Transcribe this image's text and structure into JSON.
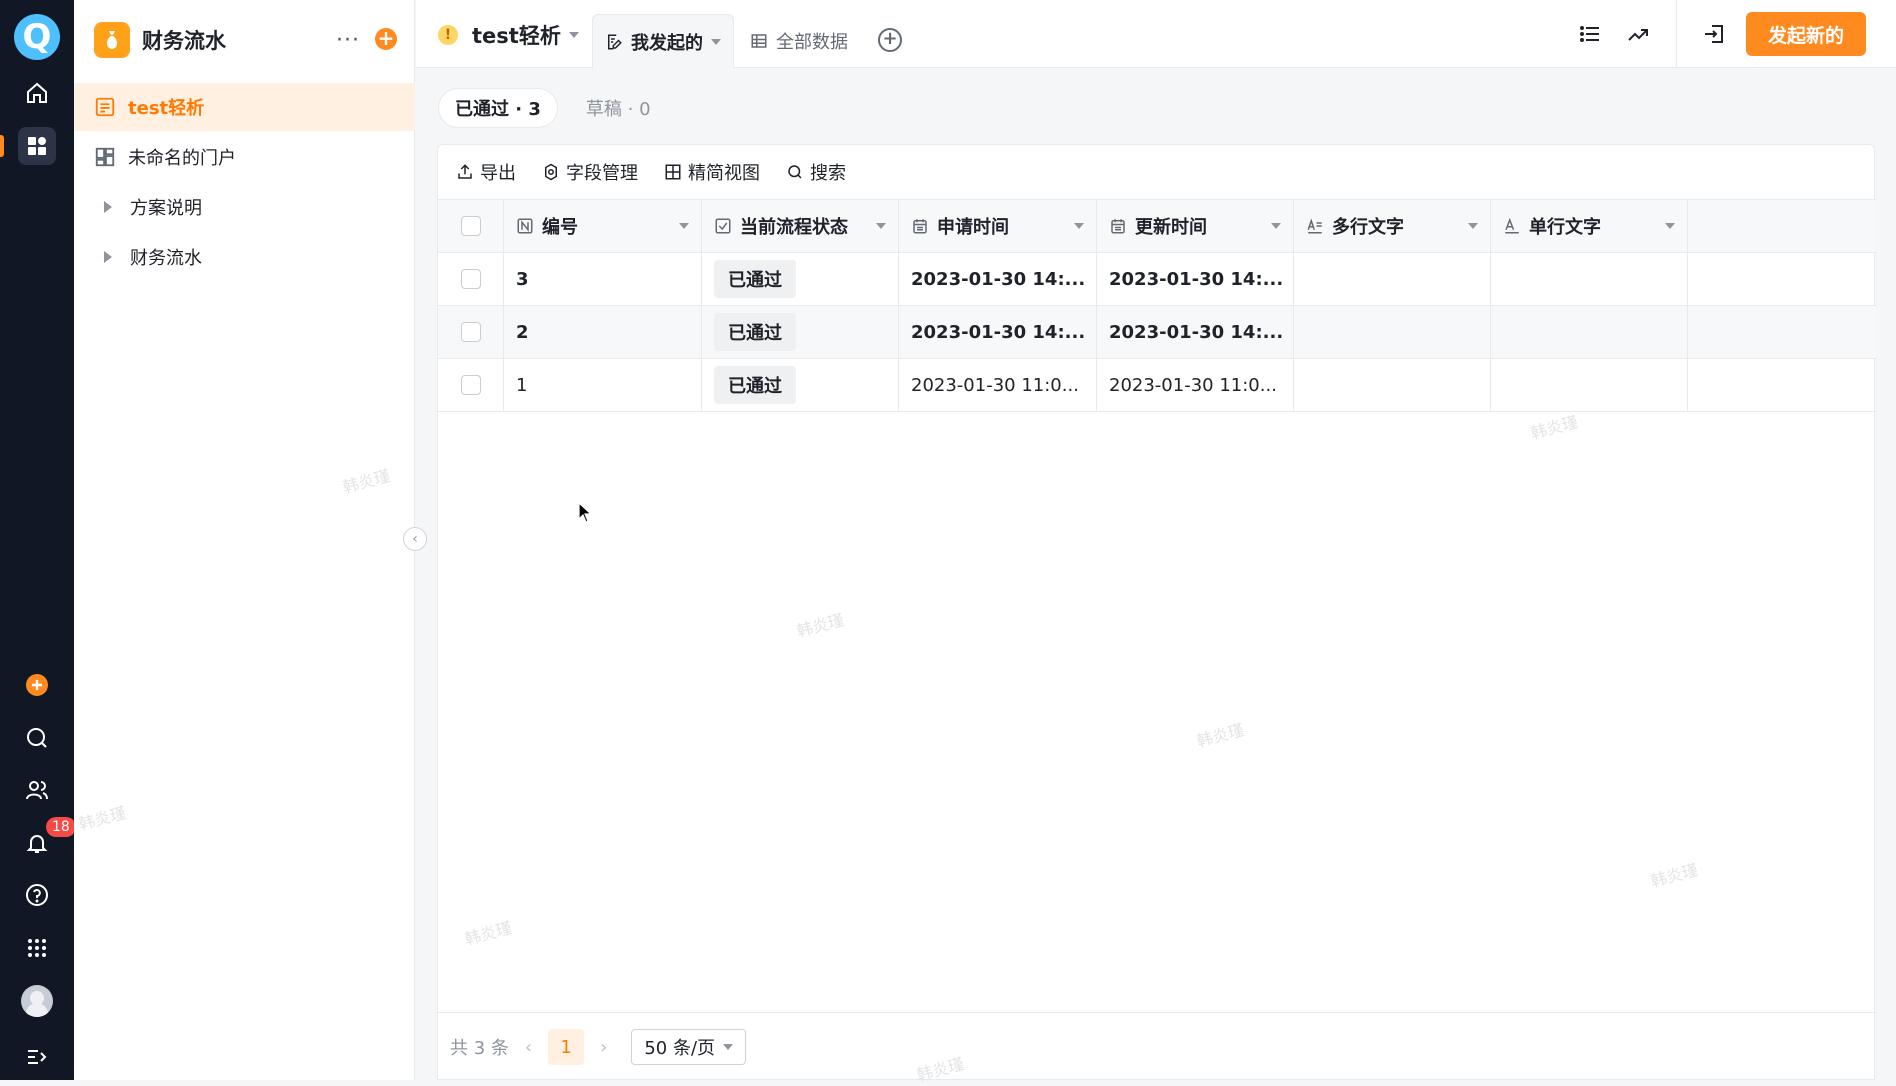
{
  "rail": {
    "logo": "Q",
    "notifications_count": "18"
  },
  "app": {
    "title": "财务流水"
  },
  "sidebar": {
    "items": [
      {
        "label": "test轻析"
      },
      {
        "label": "未命名的门户"
      },
      {
        "label": "方案说明"
      },
      {
        "label": "财务流水"
      }
    ]
  },
  "topbar": {
    "form_title": "test轻析",
    "tabs": [
      {
        "label": "我发起的"
      },
      {
        "label": "全部数据"
      }
    ],
    "primary_button": "发起新的"
  },
  "status_tabs": [
    {
      "label": "已通过 · 3"
    },
    {
      "label": "草稿 · 0"
    }
  ],
  "toolbar": {
    "export": "导出",
    "fields": "字段管理",
    "compact_view": "精简视图",
    "search": "搜索"
  },
  "table": {
    "columns": [
      {
        "label": "编号"
      },
      {
        "label": "当前流程状态"
      },
      {
        "label": "申请时间"
      },
      {
        "label": "更新时间"
      },
      {
        "label": "多行文字"
      },
      {
        "label": "单行文字"
      }
    ],
    "rows": [
      {
        "id": "3",
        "status": "已通过",
        "applied": "2023-01-30 14:...",
        "updated": "2023-01-30 14:..."
      },
      {
        "id": "2",
        "status": "已通过",
        "applied": "2023-01-30 14:...",
        "updated": "2023-01-30 14:..."
      },
      {
        "id": "1",
        "status": "已通过",
        "applied": "2023-01-30 11:0...",
        "updated": "2023-01-30 11:0..."
      }
    ]
  },
  "footer": {
    "total": "共 3 条",
    "current_page": "1",
    "page_size": "50 条/页"
  },
  "watermark": "韩炎瑾",
  "colors": {
    "accent": "#ff8a1f",
    "rail": "#121726"
  }
}
